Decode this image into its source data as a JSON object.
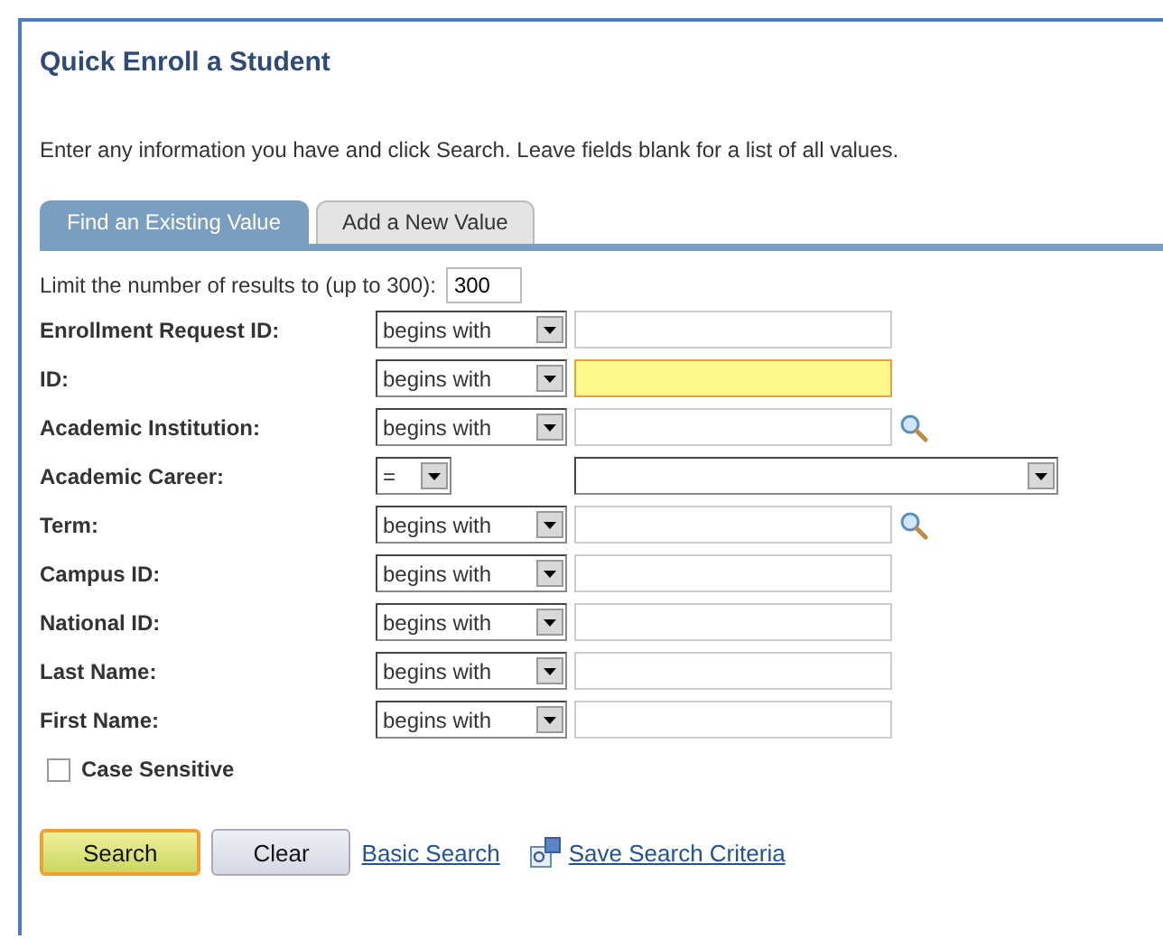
{
  "title": "Quick Enroll a Student",
  "instructions": "Enter any information you have and click Search. Leave fields blank for a list of all values.",
  "tabs": [
    {
      "label": "Find an Existing Value",
      "selected": true
    },
    {
      "label": "Add a New Value",
      "selected": false
    }
  ],
  "limit": {
    "label": "Limit the number of results to (up to 300):",
    "value": "300"
  },
  "fields": [
    {
      "label": "Enrollment Request ID:",
      "operator": "begins with",
      "kind": "text"
    },
    {
      "label": "ID:",
      "operator": "begins with",
      "kind": "highlighted"
    },
    {
      "label": "Academic Institution:",
      "operator": "begins with",
      "kind": "lookup"
    },
    {
      "label": "Academic Career:",
      "operator": "=",
      "kind": "dropdown"
    },
    {
      "label": "Term:",
      "operator": "begins with",
      "kind": "lookup"
    },
    {
      "label": "Campus ID:",
      "operator": "begins with",
      "kind": "text"
    },
    {
      "label": "National ID:",
      "operator": "begins with",
      "kind": "text"
    },
    {
      "label": "Last Name:",
      "operator": "begins with",
      "kind": "text"
    },
    {
      "label": "First Name:",
      "operator": "begins with",
      "kind": "text"
    }
  ],
  "case_sensitive": {
    "label": "Case Sensitive",
    "checked": false
  },
  "buttons": [
    {
      "label": "Search",
      "kind": "primary"
    },
    {
      "label": "Clear",
      "kind": "secondary"
    }
  ],
  "links": [
    {
      "label": "Basic Search",
      "kind": "plain"
    },
    {
      "label": "Save Search Criteria",
      "kind": "with-icon"
    }
  ]
}
